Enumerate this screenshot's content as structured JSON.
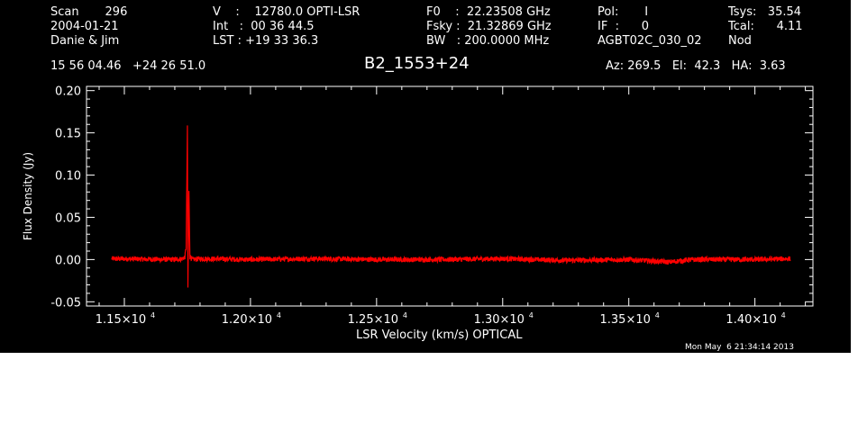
{
  "header": {
    "row1": [
      {
        "id": "scan",
        "text": "Scan       296"
      },
      {
        "id": "v",
        "text": "V    :    12780.0 OPTI-LSR"
      },
      {
        "id": "f0",
        "text": "F0    :  22.23508 GHz"
      },
      {
        "id": "pol",
        "text": "Pol:       I"
      },
      {
        "id": "tsys",
        "text": "Tsys:   35.54"
      }
    ],
    "row2": [
      {
        "id": "date",
        "text": "2004-01-21"
      },
      {
        "id": "int",
        "text": "Int   :  00 36 44.5"
      },
      {
        "id": "fsky",
        "text": "Fsky :  21.32869 GHz"
      },
      {
        "id": "if",
        "text": "IF  :      0"
      },
      {
        "id": "tcal",
        "text": "Tcal:      4.11"
      }
    ],
    "row3": [
      {
        "id": "observer",
        "text": "Danie & Jim"
      },
      {
        "id": "lst",
        "text": "LST : +19 33 36.3"
      },
      {
        "id": "bw",
        "text": "BW   : 200.0000 MHz"
      },
      {
        "id": "project",
        "text": "AGBT02C_030_02"
      },
      {
        "id": "mode",
        "text": "Nod"
      }
    ],
    "coords": "15 56 04.46   +24 26 51.0",
    "source": "B2_1553+24",
    "az_el_ha": "Az: 269.5   El:  42.3   HA:  3.63"
  },
  "footer": {
    "timestamp": "Mon May  6 21:34:14 2013"
  },
  "colors": {
    "background": "#000000",
    "axes": "#ffffff",
    "trace": "#ff0000"
  },
  "chart_data": {
    "type": "line",
    "title": "B2_1553+24",
    "xlabel": "LSR Velocity (km/s) OPTICAL",
    "ylabel": "Flux Density (Jy)",
    "xlim": [
      11350,
      14230
    ],
    "ylim": [
      -0.055,
      0.205
    ],
    "xticks": [
      11500,
      12000,
      12500,
      13000,
      13500,
      14000
    ],
    "xtick_labels": [
      {
        "mant": "1.15×10",
        "exp": "4"
      },
      {
        "mant": "1.20×10",
        "exp": "4"
      },
      {
        "mant": "1.25×10",
        "exp": "4"
      },
      {
        "mant": "1.30×10",
        "exp": "4"
      },
      {
        "mant": "1.35×10",
        "exp": "4"
      },
      {
        "mant": "1.40×10",
        "exp": "4"
      }
    ],
    "yticks": [
      -0.05,
      0.0,
      0.05,
      0.1,
      0.15,
      0.2
    ],
    "ytick_labels": [
      "-0.05",
      "0.00",
      "0.05",
      "0.10",
      "0.15",
      "0.20"
    ],
    "grid": false,
    "series": [
      {
        "x": [
          11450,
          11700,
          11730,
          11740,
          11745,
          11750,
          11752,
          11756,
          11760,
          11770,
          11800,
          12000,
          12250,
          12500,
          12750,
          13000,
          13250,
          13500,
          13660,
          13750,
          14000,
          14140
        ],
        "y": [
          0.001,
          0.0,
          0.001,
          0.003,
          0.015,
          0.156,
          -0.033,
          0.08,
          0.004,
          0.0,
          0.001,
          0.0,
          0.001,
          0.0,
          0.0,
          0.001,
          -0.001,
          0.0,
          -0.003,
          0.0,
          0.0,
          0.001
        ]
      }
    ]
  }
}
